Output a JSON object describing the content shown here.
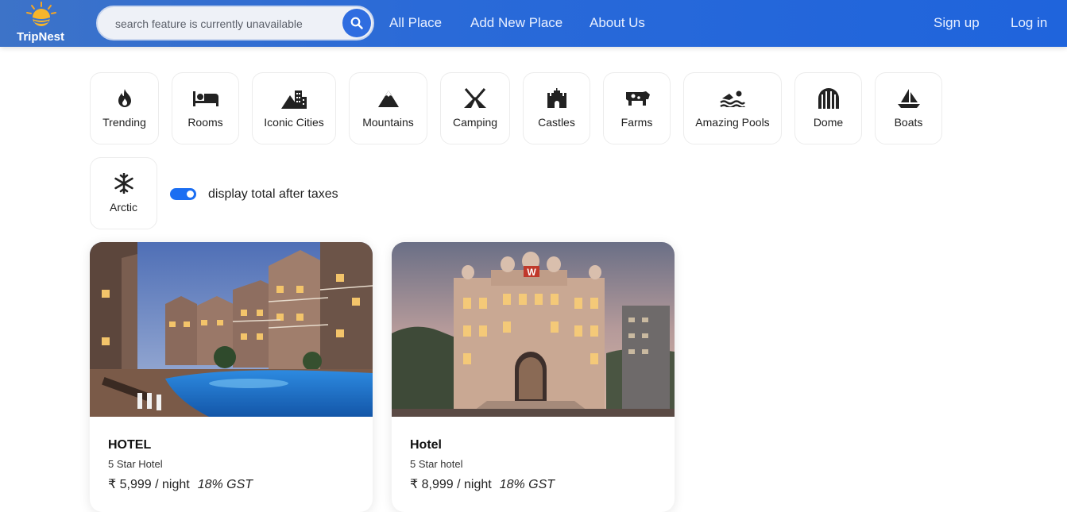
{
  "brand": {
    "name": "TripNest"
  },
  "search": {
    "placeholder": "search feature is currently unavailable",
    "icon": "search-icon"
  },
  "nav": {
    "links": [
      "All Place",
      "Add New Place",
      "About Us"
    ],
    "auth": [
      "Sign up",
      "Log in"
    ]
  },
  "categories": [
    {
      "label": "Trending",
      "icon": "fire-icon"
    },
    {
      "label": "Rooms",
      "icon": "bed-icon"
    },
    {
      "label": "Iconic Cities",
      "icon": "city-icon"
    },
    {
      "label": "Mountains",
      "icon": "mountain-icon"
    },
    {
      "label": "Camping",
      "icon": "tent-icon"
    },
    {
      "label": "Castles",
      "icon": "castle-icon"
    },
    {
      "label": "Farms",
      "icon": "cow-icon"
    },
    {
      "label": "Amazing Pools",
      "icon": "swimmer-icon"
    },
    {
      "label": "Dome",
      "icon": "dome-icon"
    },
    {
      "label": "Boats",
      "icon": "sailboat-icon"
    },
    {
      "label": "Arctic",
      "icon": "snowflake-icon"
    }
  ],
  "tax_toggle": {
    "label": "display total after taxes",
    "on": true
  },
  "listings": [
    {
      "title": "HOTEL",
      "subtitle": "5 Star Hotel",
      "price": "₹ 5,999 / night",
      "tax": "18% GST",
      "extra": ""
    },
    {
      "title": "Hotel",
      "subtitle": "5 Star hotel",
      "price": "₹ 8,999 / night",
      "tax": "18% GST",
      "extra": ""
    }
  ],
  "colors": {
    "accent": "#1b6ef2",
    "navbar": "#2a6ad8"
  }
}
